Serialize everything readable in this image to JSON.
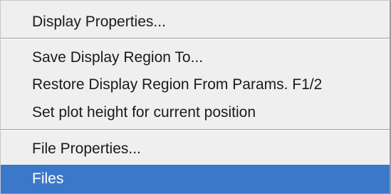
{
  "menu": {
    "items": [
      {
        "label": "Display Properties..."
      },
      {
        "label": "Save Display Region To..."
      },
      {
        "label": "Restore Display Region From Params. F1/2"
      },
      {
        "label": "Set plot height for current position"
      },
      {
        "label": "File Properties..."
      },
      {
        "label": "Files",
        "selected": true
      }
    ],
    "colors": {
      "background": "#efefef",
      "selected_background": "#3b78c9",
      "selected_text": "#ffffff",
      "text": "#1a1a1a"
    }
  }
}
